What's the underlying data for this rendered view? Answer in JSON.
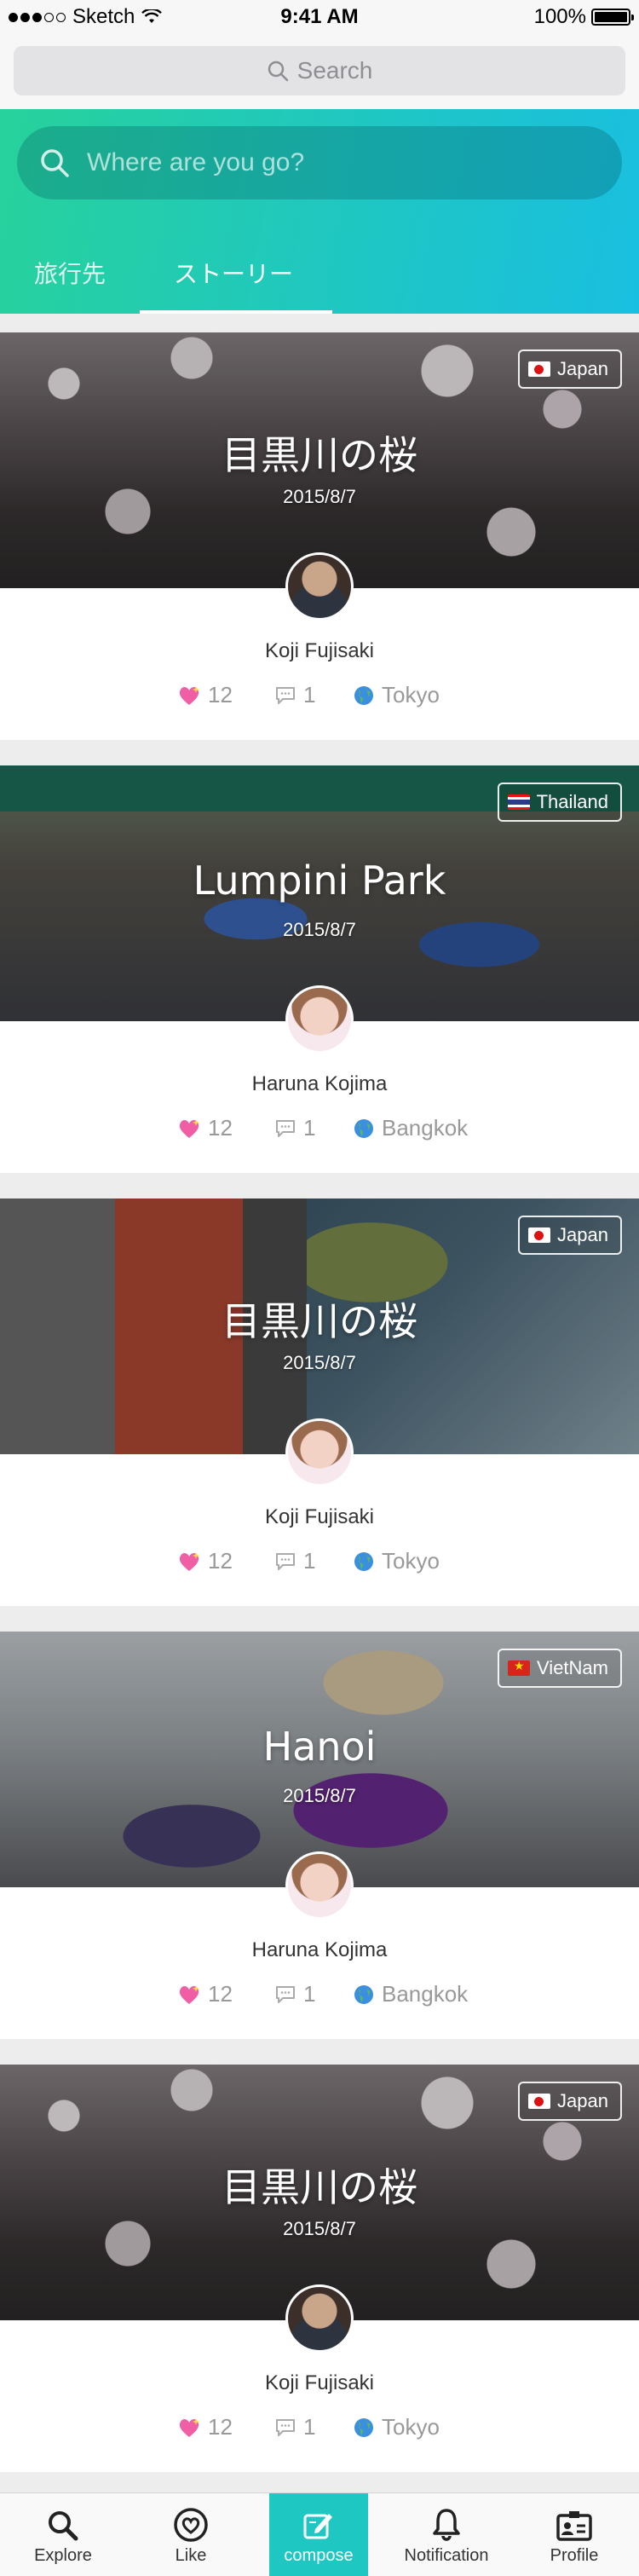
{
  "status_bar": {
    "carrier": "Sketch",
    "time": "9:41 AM",
    "battery": "100%"
  },
  "top_search": {
    "placeholder": "Search"
  },
  "hero": {
    "where_placeholder": "Where are you go?",
    "tabs": [
      {
        "label": "旅行先"
      },
      {
        "label": "ストーリー",
        "active": true
      }
    ]
  },
  "stories": [
    {
      "title": "目黒川の桜",
      "date": "2015/8/7",
      "country": "Japan",
      "flag": "jp",
      "author": "Koji Fujisaki",
      "likes": "12",
      "comments": "1",
      "location": "Tokyo",
      "photo": "sakura"
    },
    {
      "title": "Lumpini Park",
      "date": "2015/8/7",
      "country": "Thailand",
      "flag": "th",
      "author": "Haruna Kojima",
      "likes": "12",
      "comments": "1",
      "location": "Bangkok",
      "photo": "park"
    },
    {
      "title": "目黒川の桜",
      "date": "2015/8/7",
      "country": "Japan",
      "flag": "jp",
      "author": "Koji Fujisaki",
      "likes": "12",
      "comments": "1",
      "location": "Tokyo",
      "photo": "street"
    },
    {
      "title": "Hanoi",
      "date": "2015/8/7",
      "country": "VietNam",
      "flag": "vn",
      "author": "Haruna Kojima",
      "likes": "12",
      "comments": "1",
      "location": "Bangkok",
      "photo": "hanoi"
    },
    {
      "title": "目黒川の桜",
      "date": "2015/8/7",
      "country": "Japan",
      "flag": "jp",
      "author": "Koji Fujisaki",
      "likes": "12",
      "comments": "1",
      "location": "Tokyo",
      "photo": "sakura"
    }
  ],
  "tab_bar": {
    "items": [
      {
        "label": "Explore",
        "icon": "search-icon"
      },
      {
        "label": "Like",
        "icon": "heart-icon"
      },
      {
        "label": "compose",
        "icon": "compose-icon",
        "active": true
      },
      {
        "label": "Notification",
        "icon": "bell-icon"
      },
      {
        "label": "Profile",
        "icon": "id-card-icon"
      }
    ]
  },
  "colors": {
    "accent": "#1fc7c2",
    "gradient_start": "#27d29b",
    "gradient_end": "#19bfe0"
  }
}
